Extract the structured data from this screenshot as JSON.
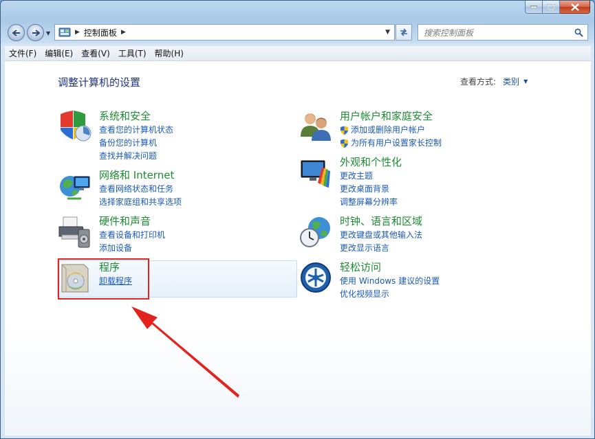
{
  "window": {
    "breadcrumb": "控制面板",
    "search_placeholder": "搜索控制面板"
  },
  "menu": [
    "文件(F)",
    "编辑(E)",
    "查看(V)",
    "工具(T)",
    "帮助(H)"
  ],
  "content": {
    "title": "调整计算机的设置",
    "view_by_label": "查看方式:",
    "view_by_value": "类别"
  },
  "categories": {
    "system": {
      "title": "系统和安全",
      "links": [
        "查看您的计算机状态",
        "备份您的计算机",
        "查找并解决问题"
      ]
    },
    "network": {
      "title": "网络和 Internet",
      "links": [
        "查看网络状态和任务",
        "选择家庭组和共享选项"
      ]
    },
    "hardware": {
      "title": "硬件和声音",
      "links": [
        "查看设备和打印机",
        "添加设备"
      ]
    },
    "programs": {
      "title": "程序",
      "links": [
        "卸载程序"
      ]
    },
    "users": {
      "title": "用户帐户和家庭安全",
      "links": [
        "添加或删除用户帐户",
        "为所有用户设置家长控制"
      ]
    },
    "appearance": {
      "title": "外观和个性化",
      "links": [
        "更改主题",
        "更改桌面背景",
        "调整屏幕分辨率"
      ]
    },
    "clock": {
      "title": "时钟、语言和区域",
      "links": [
        "更改键盘或其他输入法",
        "更改显示语言"
      ]
    },
    "ease": {
      "title": "轻松访问",
      "links": [
        "使用 Windows 建议的设置",
        "优化视频显示"
      ]
    }
  },
  "colors": {
    "category_title": "#1e8b33",
    "link": "#1a5ab7",
    "annotation": "#e5231e"
  }
}
